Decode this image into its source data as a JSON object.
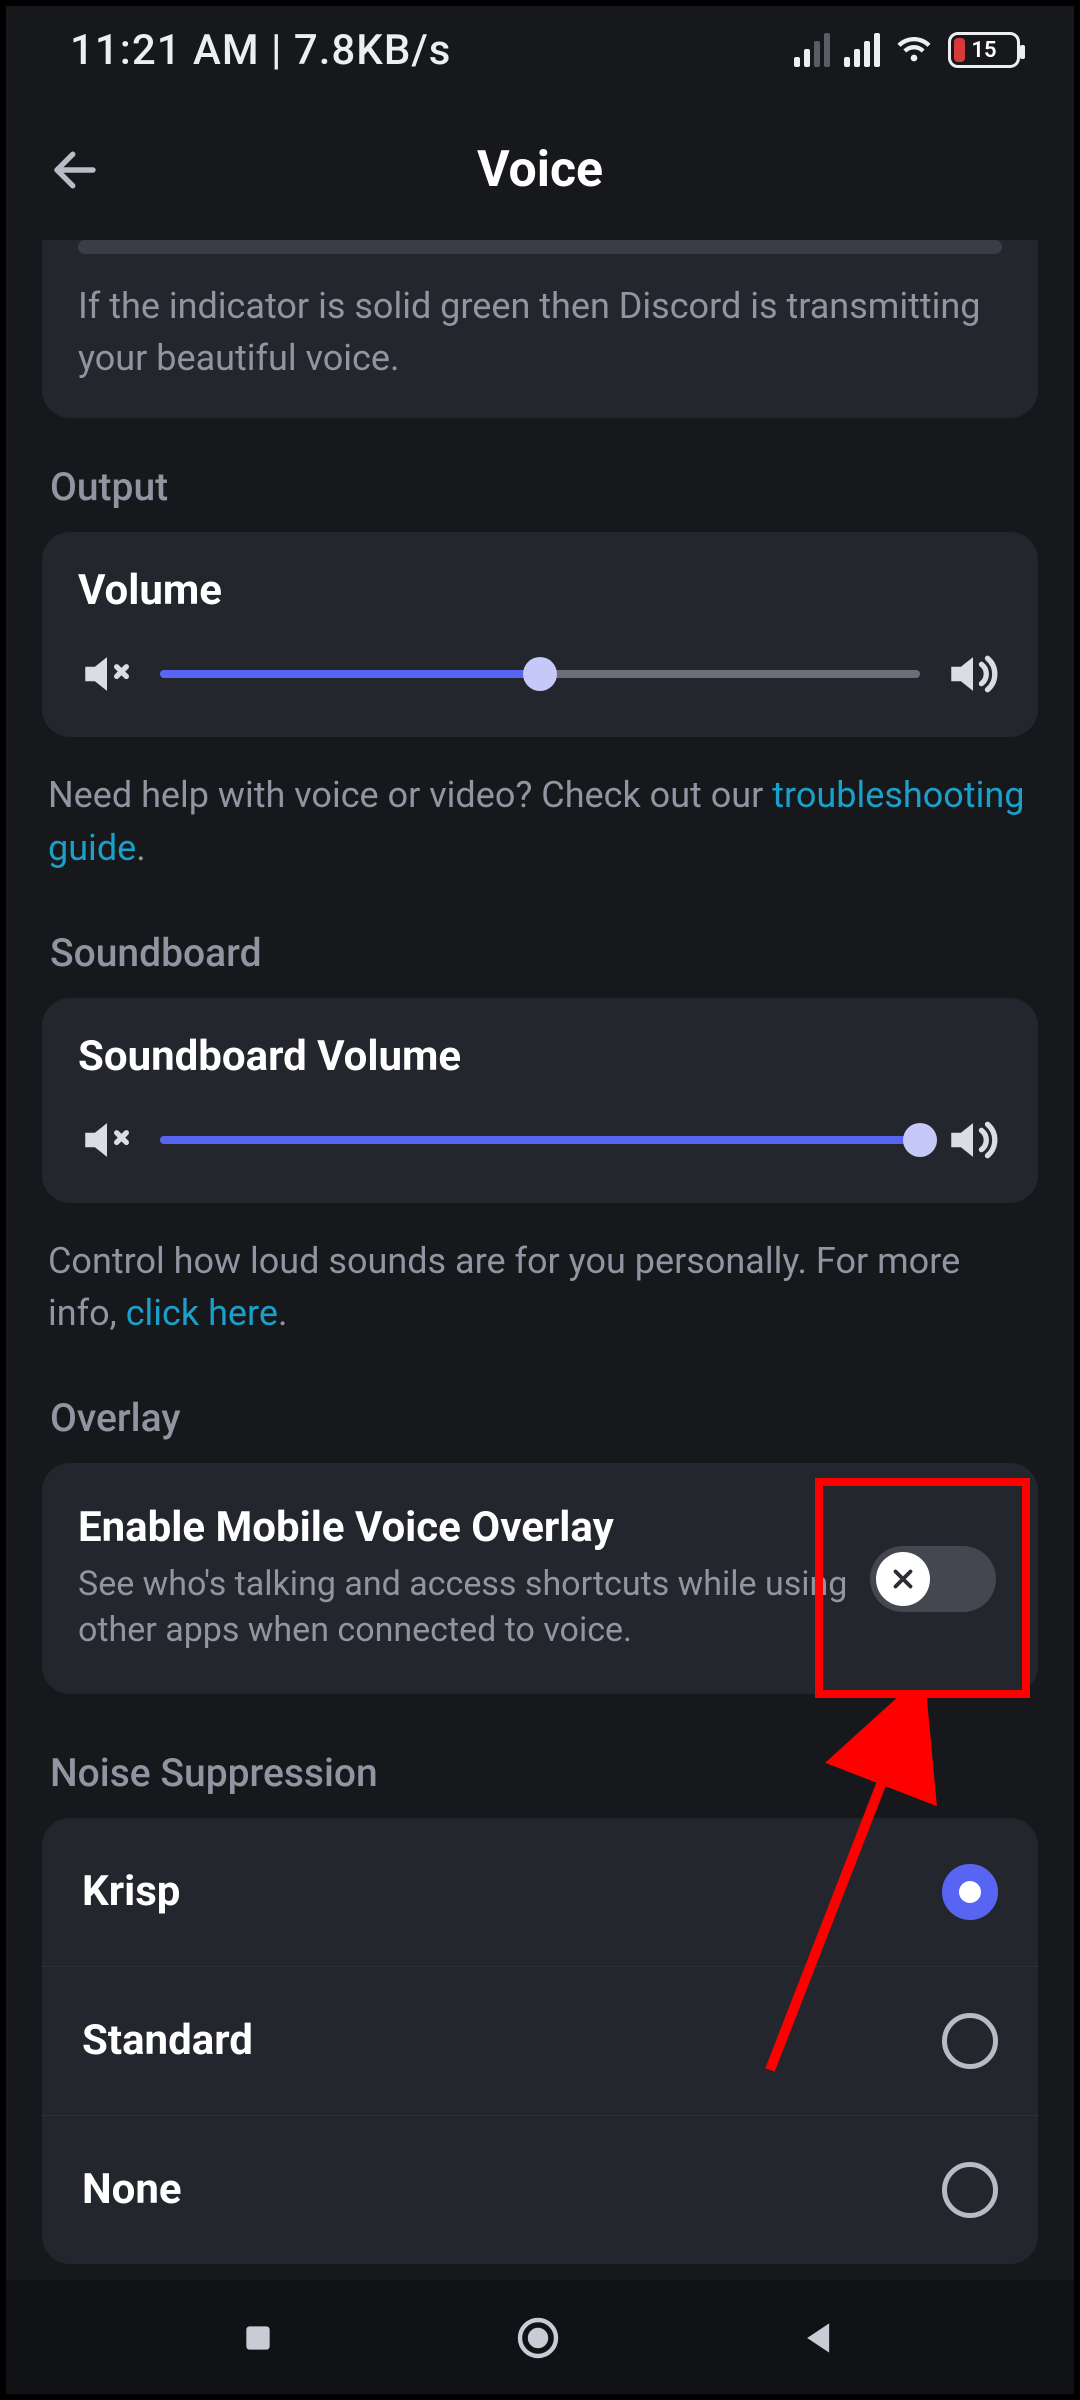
{
  "statusbar": {
    "time": "11:21 AM | 7.8KB/s",
    "battery_pct": "15"
  },
  "header": {
    "title": "Voice"
  },
  "sensitivity": {
    "hint": "If the indicator is solid green then Discord is transmitting your beautiful voice."
  },
  "output": {
    "section_label": "Output",
    "volume_label": "Volume",
    "volume_pct": 50,
    "help_prefix": "Need help with voice or video? Check out our ",
    "help_link": "troubleshooting guide",
    "help_suffix": "."
  },
  "soundboard": {
    "section_label": "Soundboard",
    "volume_label": "Soundboard Volume",
    "volume_pct": 100,
    "help_prefix": "Control how loud sounds are for you personally. For more info, ",
    "help_link": "click here",
    "help_suffix": "."
  },
  "overlay": {
    "section_label": "Overlay",
    "title": "Enable Mobile Voice Overlay",
    "desc": "See who's talking and access shortcuts while using other apps when connected to voice.",
    "enabled": false
  },
  "noise": {
    "section_label": "Noise Suppression",
    "options": [
      {
        "label": "Krisp",
        "selected": true
      },
      {
        "label": "Standard",
        "selected": false
      },
      {
        "label": "None",
        "selected": false
      }
    ]
  },
  "annotation": {
    "highlight_target": "overlay-toggle"
  }
}
